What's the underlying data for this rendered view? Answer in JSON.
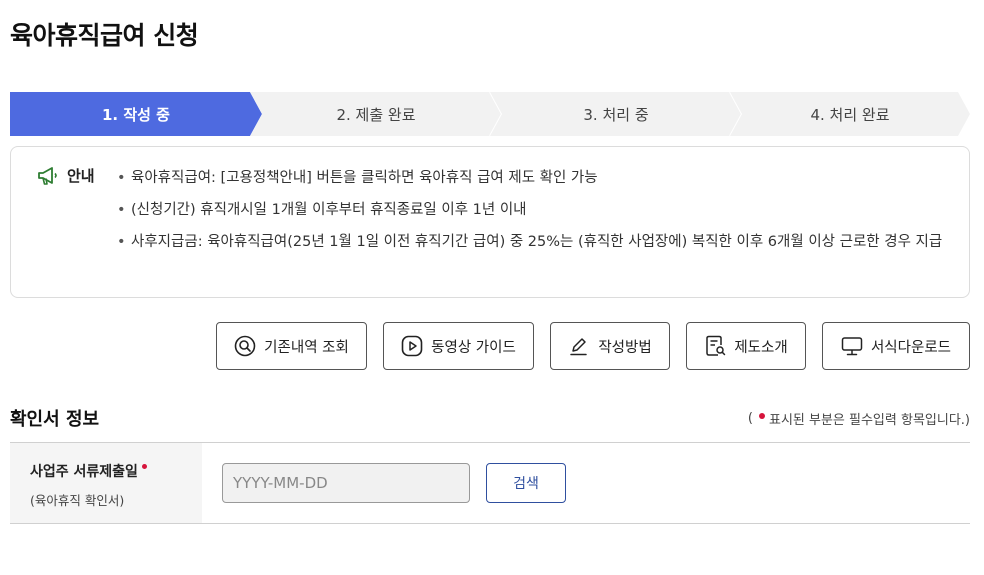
{
  "page": {
    "title": "육아휴직급여 신청"
  },
  "steps": [
    {
      "label": "1. 작성 중",
      "active": true
    },
    {
      "label": "2. 제출 완료",
      "active": false
    },
    {
      "label": "3. 처리 중",
      "active": false
    },
    {
      "label": "4. 처리 완료",
      "active": false
    }
  ],
  "colors": {
    "accent": "#4e6ae0",
    "step_inactive": "#f2f2f2",
    "required": "#d6143c",
    "notice_icon": "#2e7d32",
    "button_blue": "#2f4f9f"
  },
  "notice": {
    "icon": "megaphone-icon",
    "label": "안내",
    "items": [
      "육아휴직급여: [고용정책안내] 버튼을 클릭하면 육아휴직 급여 제도 확인 가능",
      "(신청기간) 휴직개시일 1개월 이후부터 휴직종료일 이후 1년 이내",
      "사후지급금: 육아휴직급여(25년 1월 1일 이전 휴직기간 급여) 중 25%는 (휴직한 사업장에) 복직한 이후 6개월 이상 근로한 경우 지급"
    ]
  },
  "actions": [
    {
      "label": "기존내역 조회",
      "icon": "search-icon"
    },
    {
      "label": "동영상 가이드",
      "icon": "play-icon"
    },
    {
      "label": "작성방법",
      "icon": "pencil-icon"
    },
    {
      "label": "제도소개",
      "icon": "document-search-icon"
    },
    {
      "label": "서식다운로드",
      "icon": "monitor-icon"
    }
  ],
  "section": {
    "title": "확인서 정보",
    "required_note_prefix": "(",
    "required_note_text": "표시된 부분은 필수입력 항목입니다.)"
  },
  "form": {
    "field_label": "사업주 서류제출일",
    "field_sublabel": "(육아휴직 확인서)",
    "date_placeholder": "YYYY-MM-DD",
    "search_label": "검색"
  }
}
